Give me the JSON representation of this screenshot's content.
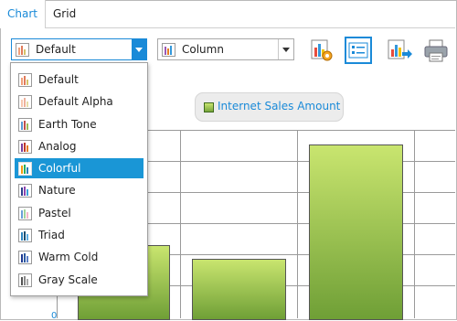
{
  "tabs": [
    {
      "label": "Chart",
      "active": true
    },
    {
      "label": "Grid",
      "active": false
    }
  ],
  "toolbar": {
    "palette_value": "Default",
    "palette_icon": "default-palette-icon",
    "chart_type_value": "Column",
    "chart_type_icon": "column-chart-icon",
    "buttons": [
      {
        "name": "chart-options-button",
        "icon": "chart-gear-icon"
      },
      {
        "name": "show-legend-button",
        "icon": "legend-icon",
        "selected": true
      },
      {
        "name": "export-chart-button",
        "icon": "chart-export-icon"
      },
      {
        "name": "print-button",
        "icon": "printer-icon"
      }
    ]
  },
  "palette_menu": {
    "items": [
      {
        "label": "Default"
      },
      {
        "label": "Default Alpha"
      },
      {
        "label": "Earth Tone"
      },
      {
        "label": "Analog"
      },
      {
        "label": "Colorful",
        "selected": true
      },
      {
        "label": "Nature"
      },
      {
        "label": "Pastel"
      },
      {
        "label": "Triad"
      },
      {
        "label": "Warm Cold"
      },
      {
        "label": "Gray Scale"
      }
    ]
  },
  "legend": {
    "label": "Internet Sales Amount"
  },
  "chart": {
    "y_axis_visible_label": "0"
  },
  "colors": {
    "accent": "#1a8ad8",
    "selected_row": "#1a96d6",
    "bar_top": "#c9e56f",
    "bar_bottom": "#6f9f36"
  }
}
